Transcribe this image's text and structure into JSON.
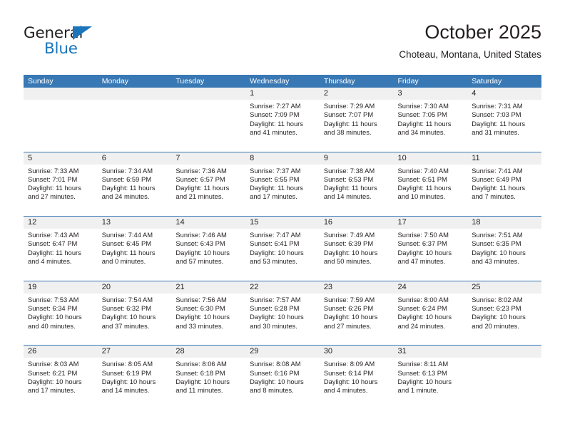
{
  "logo": {
    "line1": "General",
    "line2": "Blue",
    "triangle_color": "#1b75bb",
    "text_color": "#231f20"
  },
  "header": {
    "title": "October 2025",
    "subtitle": "Choteau, Montana, United States"
  },
  "colors": {
    "header_bar": "#3878b4",
    "date_band": "#f0f0f0",
    "text": "#231f20",
    "accent": "#1b75bb"
  },
  "weekdays": [
    "Sunday",
    "Monday",
    "Tuesday",
    "Wednesday",
    "Thursday",
    "Friday",
    "Saturday"
  ],
  "weeks": [
    [
      {
        "day": "",
        "empty": true
      },
      {
        "day": "",
        "empty": true
      },
      {
        "day": "",
        "empty": true
      },
      {
        "day": "1",
        "sunrise": "Sunrise: 7:27 AM",
        "sunset": "Sunset: 7:09 PM",
        "daylight_1": "Daylight: 11 hours",
        "daylight_2": "and 41 minutes."
      },
      {
        "day": "2",
        "sunrise": "Sunrise: 7:29 AM",
        "sunset": "Sunset: 7:07 PM",
        "daylight_1": "Daylight: 11 hours",
        "daylight_2": "and 38 minutes."
      },
      {
        "day": "3",
        "sunrise": "Sunrise: 7:30 AM",
        "sunset": "Sunset: 7:05 PM",
        "daylight_1": "Daylight: 11 hours",
        "daylight_2": "and 34 minutes."
      },
      {
        "day": "4",
        "sunrise": "Sunrise: 7:31 AM",
        "sunset": "Sunset: 7:03 PM",
        "daylight_1": "Daylight: 11 hours",
        "daylight_2": "and 31 minutes."
      }
    ],
    [
      {
        "day": "5",
        "sunrise": "Sunrise: 7:33 AM",
        "sunset": "Sunset: 7:01 PM",
        "daylight_1": "Daylight: 11 hours",
        "daylight_2": "and 27 minutes."
      },
      {
        "day": "6",
        "sunrise": "Sunrise: 7:34 AM",
        "sunset": "Sunset: 6:59 PM",
        "daylight_1": "Daylight: 11 hours",
        "daylight_2": "and 24 minutes."
      },
      {
        "day": "7",
        "sunrise": "Sunrise: 7:36 AM",
        "sunset": "Sunset: 6:57 PM",
        "daylight_1": "Daylight: 11 hours",
        "daylight_2": "and 21 minutes."
      },
      {
        "day": "8",
        "sunrise": "Sunrise: 7:37 AM",
        "sunset": "Sunset: 6:55 PM",
        "daylight_1": "Daylight: 11 hours",
        "daylight_2": "and 17 minutes."
      },
      {
        "day": "9",
        "sunrise": "Sunrise: 7:38 AM",
        "sunset": "Sunset: 6:53 PM",
        "daylight_1": "Daylight: 11 hours",
        "daylight_2": "and 14 minutes."
      },
      {
        "day": "10",
        "sunrise": "Sunrise: 7:40 AM",
        "sunset": "Sunset: 6:51 PM",
        "daylight_1": "Daylight: 11 hours",
        "daylight_2": "and 10 minutes."
      },
      {
        "day": "11",
        "sunrise": "Sunrise: 7:41 AM",
        "sunset": "Sunset: 6:49 PM",
        "daylight_1": "Daylight: 11 hours",
        "daylight_2": "and 7 minutes."
      }
    ],
    [
      {
        "day": "12",
        "sunrise": "Sunrise: 7:43 AM",
        "sunset": "Sunset: 6:47 PM",
        "daylight_1": "Daylight: 11 hours",
        "daylight_2": "and 4 minutes."
      },
      {
        "day": "13",
        "sunrise": "Sunrise: 7:44 AM",
        "sunset": "Sunset: 6:45 PM",
        "daylight_1": "Daylight: 11 hours",
        "daylight_2": "and 0 minutes."
      },
      {
        "day": "14",
        "sunrise": "Sunrise: 7:46 AM",
        "sunset": "Sunset: 6:43 PM",
        "daylight_1": "Daylight: 10 hours",
        "daylight_2": "and 57 minutes."
      },
      {
        "day": "15",
        "sunrise": "Sunrise: 7:47 AM",
        "sunset": "Sunset: 6:41 PM",
        "daylight_1": "Daylight: 10 hours",
        "daylight_2": "and 53 minutes."
      },
      {
        "day": "16",
        "sunrise": "Sunrise: 7:49 AM",
        "sunset": "Sunset: 6:39 PM",
        "daylight_1": "Daylight: 10 hours",
        "daylight_2": "and 50 minutes."
      },
      {
        "day": "17",
        "sunrise": "Sunrise: 7:50 AM",
        "sunset": "Sunset: 6:37 PM",
        "daylight_1": "Daylight: 10 hours",
        "daylight_2": "and 47 minutes."
      },
      {
        "day": "18",
        "sunrise": "Sunrise: 7:51 AM",
        "sunset": "Sunset: 6:35 PM",
        "daylight_1": "Daylight: 10 hours",
        "daylight_2": "and 43 minutes."
      }
    ],
    [
      {
        "day": "19",
        "sunrise": "Sunrise: 7:53 AM",
        "sunset": "Sunset: 6:34 PM",
        "daylight_1": "Daylight: 10 hours",
        "daylight_2": "and 40 minutes."
      },
      {
        "day": "20",
        "sunrise": "Sunrise: 7:54 AM",
        "sunset": "Sunset: 6:32 PM",
        "daylight_1": "Daylight: 10 hours",
        "daylight_2": "and 37 minutes."
      },
      {
        "day": "21",
        "sunrise": "Sunrise: 7:56 AM",
        "sunset": "Sunset: 6:30 PM",
        "daylight_1": "Daylight: 10 hours",
        "daylight_2": "and 33 minutes."
      },
      {
        "day": "22",
        "sunrise": "Sunrise: 7:57 AM",
        "sunset": "Sunset: 6:28 PM",
        "daylight_1": "Daylight: 10 hours",
        "daylight_2": "and 30 minutes."
      },
      {
        "day": "23",
        "sunrise": "Sunrise: 7:59 AM",
        "sunset": "Sunset: 6:26 PM",
        "daylight_1": "Daylight: 10 hours",
        "daylight_2": "and 27 minutes."
      },
      {
        "day": "24",
        "sunrise": "Sunrise: 8:00 AM",
        "sunset": "Sunset: 6:24 PM",
        "daylight_1": "Daylight: 10 hours",
        "daylight_2": "and 24 minutes."
      },
      {
        "day": "25",
        "sunrise": "Sunrise: 8:02 AM",
        "sunset": "Sunset: 6:23 PM",
        "daylight_1": "Daylight: 10 hours",
        "daylight_2": "and 20 minutes."
      }
    ],
    [
      {
        "day": "26",
        "sunrise": "Sunrise: 8:03 AM",
        "sunset": "Sunset: 6:21 PM",
        "daylight_1": "Daylight: 10 hours",
        "daylight_2": "and 17 minutes."
      },
      {
        "day": "27",
        "sunrise": "Sunrise: 8:05 AM",
        "sunset": "Sunset: 6:19 PM",
        "daylight_1": "Daylight: 10 hours",
        "daylight_2": "and 14 minutes."
      },
      {
        "day": "28",
        "sunrise": "Sunrise: 8:06 AM",
        "sunset": "Sunset: 6:18 PM",
        "daylight_1": "Daylight: 10 hours",
        "daylight_2": "and 11 minutes."
      },
      {
        "day": "29",
        "sunrise": "Sunrise: 8:08 AM",
        "sunset": "Sunset: 6:16 PM",
        "daylight_1": "Daylight: 10 hours",
        "daylight_2": "and 8 minutes."
      },
      {
        "day": "30",
        "sunrise": "Sunrise: 8:09 AM",
        "sunset": "Sunset: 6:14 PM",
        "daylight_1": "Daylight: 10 hours",
        "daylight_2": "and 4 minutes."
      },
      {
        "day": "31",
        "sunrise": "Sunrise: 8:11 AM",
        "sunset": "Sunset: 6:13 PM",
        "daylight_1": "Daylight: 10 hours",
        "daylight_2": "and 1 minute."
      },
      {
        "day": "",
        "empty": true
      }
    ]
  ]
}
